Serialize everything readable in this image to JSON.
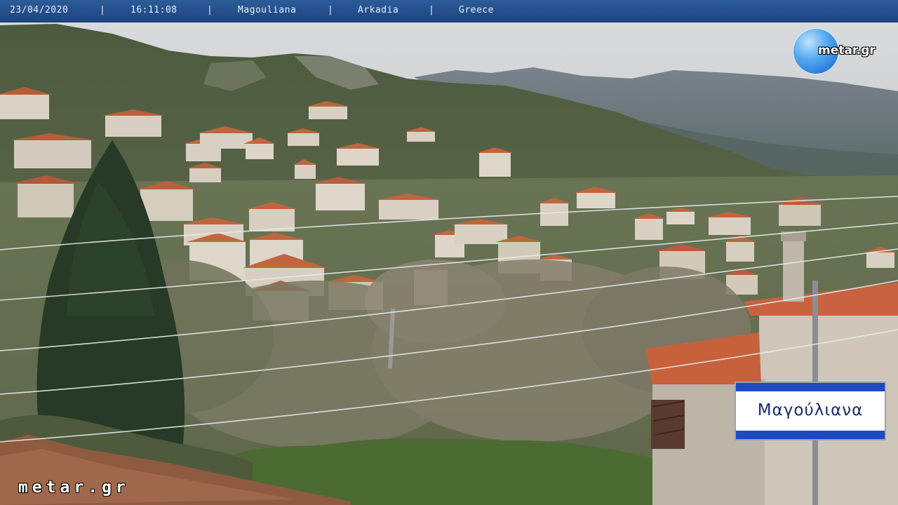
{
  "topbar": {
    "date": "23/04/2020",
    "time": "16:11:08",
    "village": "Magouliana",
    "region": "Arkadia",
    "country": "Greece",
    "separator": "|"
  },
  "logo": {
    "text": "metar.gr"
  },
  "watermark": {
    "text": "metar.gr"
  },
  "sign": {
    "text": "Μαγούλιανα"
  },
  "colors": {
    "bar": "#24508c",
    "roof": "#c0623a",
    "sign_blue": "#1f48c2"
  }
}
